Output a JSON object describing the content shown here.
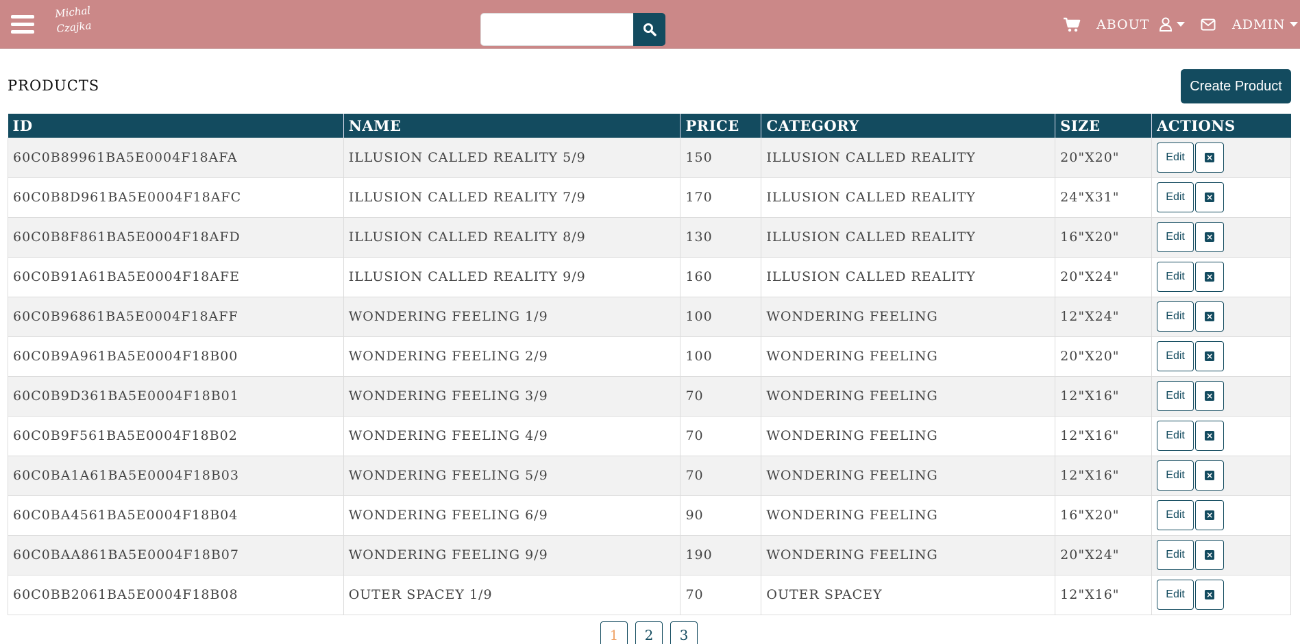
{
  "navbar": {
    "logo_text": "Michal Czajka",
    "search": {
      "placeholder": "",
      "value": ""
    },
    "about_label": "ABOUT",
    "admin_label": "ADMIN",
    "icons": [
      "menu-icon",
      "search-icon",
      "cart-icon",
      "user-icon",
      "envelope-icon"
    ]
  },
  "page": {
    "title": "PRODUCTS",
    "create_button": "Create Product"
  },
  "table": {
    "headers": [
      "ID",
      "NAME",
      "PRICE",
      "CATEGORY",
      "SIZE",
      "ACTIONS"
    ],
    "edit_label": "Edit",
    "rows": [
      {
        "id": "60C0B89961BA5E0004F18AFA",
        "name": "ILLUSION CALLED REALITY 5/9",
        "price": "150",
        "category": "ILLUSION CALLED REALITY",
        "size": "20\"X20\""
      },
      {
        "id": "60C0B8D961BA5E0004F18AFC",
        "name": "ILLUSION CALLED REALITY 7/9",
        "price": "170",
        "category": "ILLUSION CALLED REALITY",
        "size": "24\"X31\""
      },
      {
        "id": "60C0B8F861BA5E0004F18AFD",
        "name": "ILLUSION CALLED REALITY 8/9",
        "price": "130",
        "category": "ILLUSION CALLED REALITY",
        "size": "16\"X20\""
      },
      {
        "id": "60C0B91A61BA5E0004F18AFE",
        "name": "ILLUSION CALLED REALITY 9/9",
        "price": "160",
        "category": "ILLUSION CALLED REALITY",
        "size": "20\"X24\""
      },
      {
        "id": "60C0B96861BA5E0004F18AFF",
        "name": "WONDERING FEELING 1/9",
        "price": "100",
        "category": "WONDERING FEELING",
        "size": "12\"X24\""
      },
      {
        "id": "60C0B9A961BA5E0004F18B00",
        "name": "WONDERING FEELING 2/9",
        "price": "100",
        "category": "WONDERING FEELING",
        "size": "20\"X20\""
      },
      {
        "id": "60C0B9D361BA5E0004F18B01",
        "name": "WONDERING FEELING 3/9",
        "price": "70",
        "category": "WONDERING FEELING",
        "size": "12\"X16\""
      },
      {
        "id": "60C0B9F561BA5E0004F18B02",
        "name": "WONDERING FEELING 4/9",
        "price": "70",
        "category": "WONDERING FEELING",
        "size": "12\"X16\""
      },
      {
        "id": "60C0BA1A61BA5E0004F18B03",
        "name": "WONDERING FEELING 5/9",
        "price": "70",
        "category": "WONDERING FEELING",
        "size": "12\"X16\""
      },
      {
        "id": "60C0BA4561BA5E0004F18B04",
        "name": "WONDERING FEELING 6/9",
        "price": "90",
        "category": "WONDERING FEELING",
        "size": "16\"X20\""
      },
      {
        "id": "60C0BAA861BA5E0004F18B07",
        "name": "WONDERING FEELING 9/9",
        "price": "190",
        "category": "WONDERING FEELING",
        "size": "20\"X24\""
      },
      {
        "id": "60C0BB2061BA5E0004F18B08",
        "name": "OUTER SPACEY 1/9",
        "price": "70",
        "category": "OUTER SPACEY",
        "size": "12\"X16\""
      }
    ]
  },
  "pagination": {
    "pages": [
      "1",
      "2",
      "3"
    ],
    "current": "1"
  },
  "colors": {
    "navbar": "#cb8888",
    "primary": "#134b5f",
    "active_page": "#f0a56a"
  }
}
